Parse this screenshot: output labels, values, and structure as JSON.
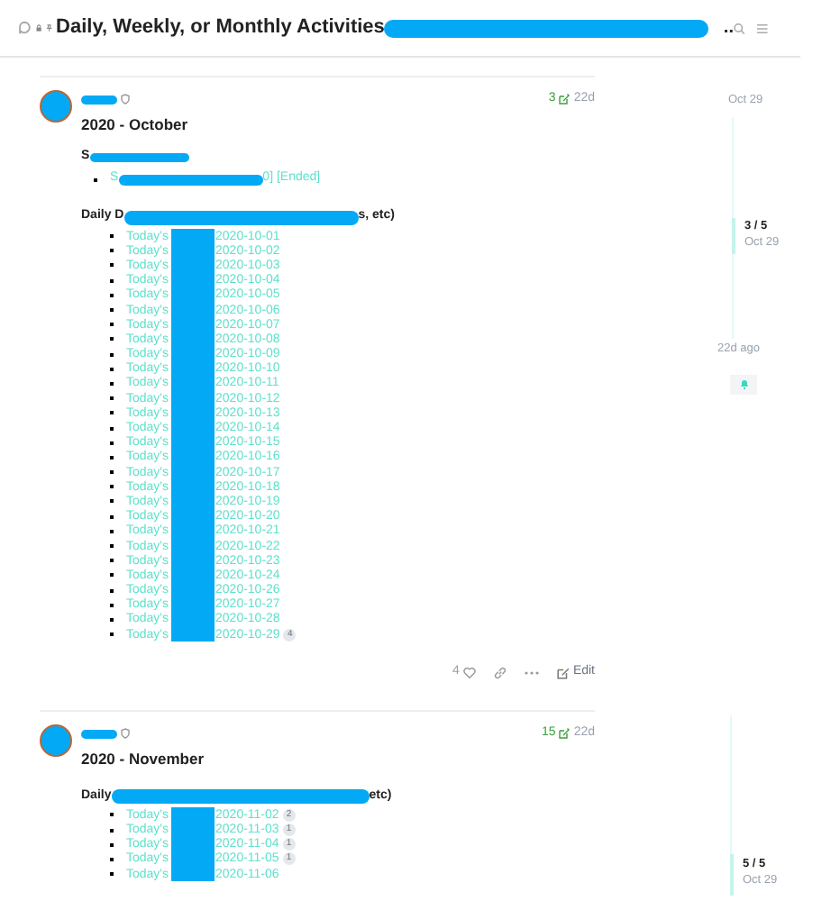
{
  "header": {
    "title": "Daily, Weekly, or Monthly Activities",
    "overflow": ".."
  },
  "posts": [
    {
      "count": "3",
      "age": "22d",
      "title": "2020 - October",
      "summary": {
        "heading_start": "S",
        "item_start": "S",
        "item_end": "0] [Ended]"
      },
      "list_heading": {
        "start": "Daily D",
        "end": "s, etc)"
      },
      "items": [
        {
          "prefix": "Today's",
          "date": "2020-10-01"
        },
        {
          "prefix": "Today's",
          "date": "2020-10-02"
        },
        {
          "prefix": "Today's",
          "date": "2020-10-03"
        },
        {
          "prefix": "Today's",
          "date": "2020-10-04"
        },
        {
          "prefix": "Today's",
          "date": "2020-10-05"
        },
        {
          "prefix": "Today's",
          "date": "2020-10-06"
        },
        {
          "prefix": "Today's",
          "date": "2020-10-07"
        },
        {
          "prefix": "Today's",
          "date": "2020-10-08"
        },
        {
          "prefix": "Today's",
          "date": "2020-10-09"
        },
        {
          "prefix": "Today's",
          "date": "2020-10-10"
        },
        {
          "prefix": "Today's",
          "date": "2020-10-11"
        },
        {
          "prefix": "Today's",
          "date": "2020-10-12"
        },
        {
          "prefix": "Today's",
          "date": "2020-10-13"
        },
        {
          "prefix": "Today's",
          "date": "2020-10-14"
        },
        {
          "prefix": "Today's",
          "date": "2020-10-15"
        },
        {
          "prefix": "Today's",
          "date": "2020-10-16"
        },
        {
          "prefix": "Today's",
          "date": "2020-10-17"
        },
        {
          "prefix": "Today's",
          "date": "2020-10-18"
        },
        {
          "prefix": "Today's",
          "date": "2020-10-19"
        },
        {
          "prefix": "Today's",
          "date": "2020-10-20"
        },
        {
          "prefix": "Today's",
          "date": "2020-10-21"
        },
        {
          "prefix": "Today's",
          "date": "2020-10-22"
        },
        {
          "prefix": "Today's",
          "date": "2020-10-23"
        },
        {
          "prefix": "Today's",
          "date": "2020-10-24"
        },
        {
          "prefix": "Today's",
          "date": "2020-10-26"
        },
        {
          "prefix": "Today's",
          "date": "2020-10-27"
        },
        {
          "prefix": "Today's",
          "date": "2020-10-28"
        },
        {
          "prefix": "Today's",
          "date": "2020-10-29",
          "badge": "4"
        }
      ],
      "actions": {
        "likes": "4",
        "edit": "Edit"
      }
    },
    {
      "count": "15",
      "age": "22d",
      "title": "2020 - November",
      "list_heading": {
        "start": "Daily",
        "end": "etc)"
      },
      "items": [
        {
          "prefix": "Today's",
          "date": "2020-11-02",
          "badge": "2"
        },
        {
          "prefix": "Today's",
          "date": "2020-11-03",
          "badge": "1"
        },
        {
          "prefix": "Today's",
          "date": "2020-11-04",
          "badge": "1"
        },
        {
          "prefix": "Today's",
          "date": "2020-11-05",
          "badge": "1"
        },
        {
          "prefix": "Today's",
          "date": "2020-11-06"
        }
      ]
    }
  ],
  "timeline": {
    "start": "Oct 29",
    "position": "3 / 5",
    "position_date": "Oct 29",
    "end": "22d ago"
  },
  "timeline_bottom": {
    "position": "5 / 5",
    "position_date": "Oct 29"
  }
}
